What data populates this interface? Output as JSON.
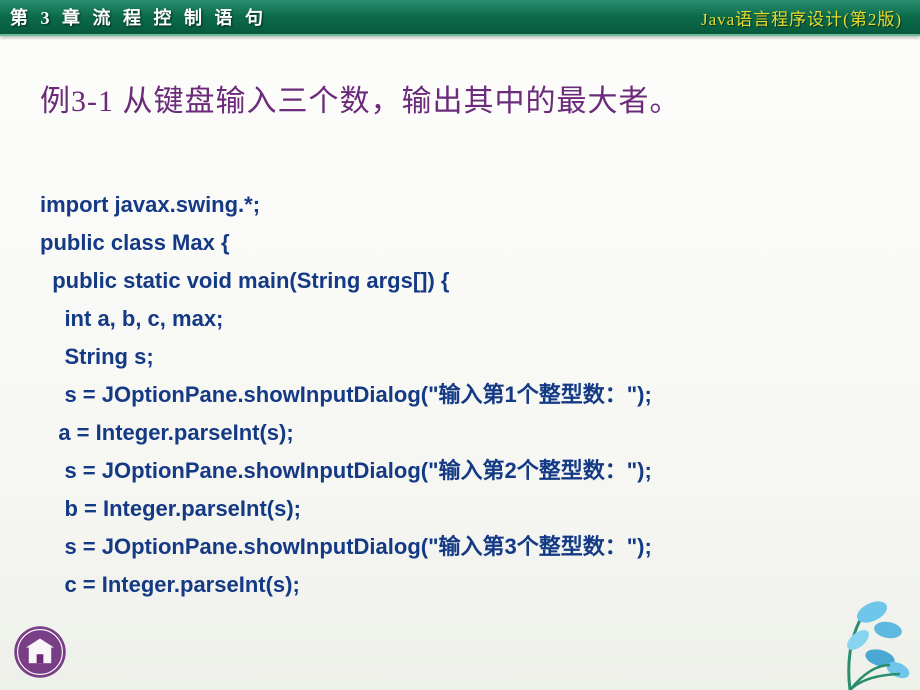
{
  "header": {
    "chapter": "第 3 章  流 程 控 制 语 句",
    "book": "Java语言程序设计(第2版)"
  },
  "title": "例3-1  从键盘输入三个数，输出其中的最大者。",
  "code": {
    "l1": "import javax.swing.*;",
    "l2": "public class Max {",
    "l3": "  public static void main(String args[]) {",
    "l4": "    int a, b, c, max;",
    "l5": "    String s;",
    "l6": "    s = JOptionPane.showInputDialog(\"输入第1个整型数：\");",
    "l7": "   a = Integer.parseInt(s);",
    "l8": "    s = JOptionPane.showInputDialog(\"输入第2个整型数：\");",
    "l9": "    b = Integer.parseInt(s);",
    "l10": "    s = JOptionPane.showInputDialog(\"输入第3个整型数：\");",
    "l11": "    c = Integer.parseInt(s);"
  }
}
